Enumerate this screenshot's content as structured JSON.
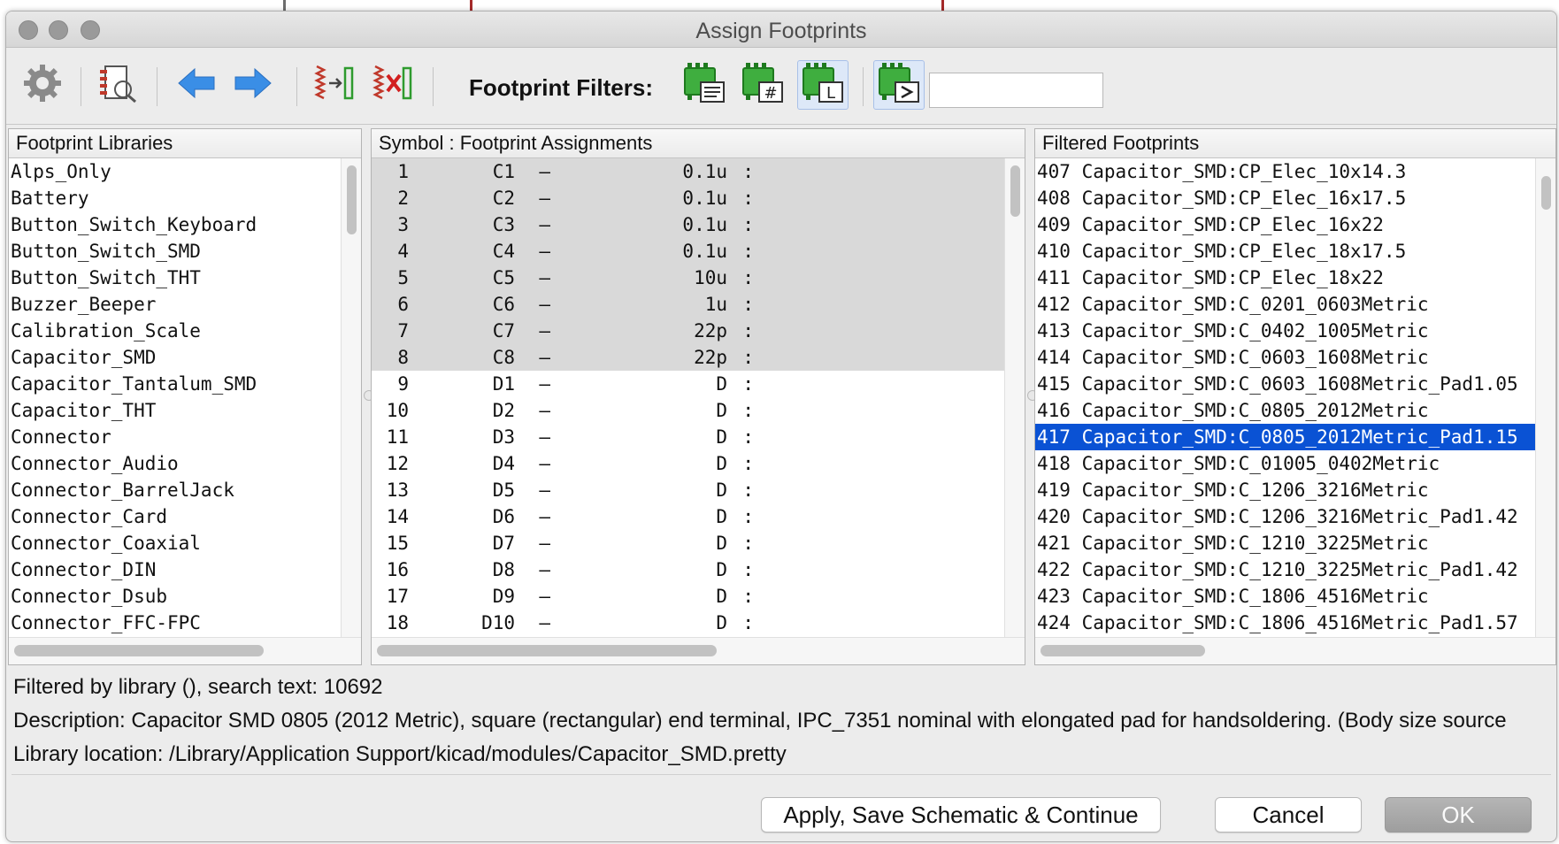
{
  "window": {
    "title": "Assign Footprints"
  },
  "toolbar": {
    "filters_label": "Footprint Filters:",
    "filter_text": ""
  },
  "libraries_panel": {
    "header": "Footprint Libraries",
    "items": [
      "Alps_Only",
      "Battery",
      "Button_Switch_Keyboard",
      "Button_Switch_SMD",
      "Button_Switch_THT",
      "Buzzer_Beeper",
      "Calibration_Scale",
      "Capacitor_SMD",
      "Capacitor_Tantalum_SMD",
      "Capacitor_THT",
      "Connector",
      "Connector_Audio",
      "Connector_BarrelJack",
      "Connector_Card",
      "Connector_Coaxial",
      "Connector_DIN",
      "Connector_Dsub",
      "Connector_FFC-FPC"
    ]
  },
  "assignments_panel": {
    "header": "Symbol : Footprint Assignments",
    "rows": [
      {
        "num": "1",
        "ref": "C1",
        "value": "0.1u"
      },
      {
        "num": "2",
        "ref": "C2",
        "value": "0.1u"
      },
      {
        "num": "3",
        "ref": "C3",
        "value": "0.1u"
      },
      {
        "num": "4",
        "ref": "C4",
        "value": "0.1u"
      },
      {
        "num": "5",
        "ref": "C5",
        "value": "10u"
      },
      {
        "num": "6",
        "ref": "C6",
        "value": "1u"
      },
      {
        "num": "7",
        "ref": "C7",
        "value": "22p"
      },
      {
        "num": "8",
        "ref": "C8",
        "value": "22p"
      },
      {
        "num": "9",
        "ref": "D1",
        "value": "D"
      },
      {
        "num": "10",
        "ref": "D2",
        "value": "D"
      },
      {
        "num": "11",
        "ref": "D3",
        "value": "D"
      },
      {
        "num": "12",
        "ref": "D4",
        "value": "D"
      },
      {
        "num": "13",
        "ref": "D5",
        "value": "D"
      },
      {
        "num": "14",
        "ref": "D6",
        "value": "D"
      },
      {
        "num": "15",
        "ref": "D7",
        "value": "D"
      },
      {
        "num": "16",
        "ref": "D8",
        "value": "D"
      },
      {
        "num": "17",
        "ref": "D9",
        "value": "D"
      },
      {
        "num": "18",
        "ref": "D10",
        "value": "D"
      }
    ],
    "shaded_count": 8
  },
  "footprints_panel": {
    "header": "Filtered Footprints",
    "items": [
      "407 Capacitor_SMD:CP_Elec_10x14.3",
      "408 Capacitor_SMD:CP_Elec_16x17.5",
      "409 Capacitor_SMD:CP_Elec_16x22",
      "410 Capacitor_SMD:CP_Elec_18x17.5",
      "411 Capacitor_SMD:CP_Elec_18x22",
      "412 Capacitor_SMD:C_0201_0603Metric",
      "413 Capacitor_SMD:C_0402_1005Metric",
      "414 Capacitor_SMD:C_0603_1608Metric",
      "415 Capacitor_SMD:C_0603_1608Metric_Pad1.05",
      "416 Capacitor_SMD:C_0805_2012Metric",
      "417 Capacitor_SMD:C_0805_2012Metric_Pad1.15",
      "418 Capacitor_SMD:C_01005_0402Metric",
      "419 Capacitor_SMD:C_1206_3216Metric",
      "420 Capacitor_SMD:C_1206_3216Metric_Pad1.42",
      "421 Capacitor_SMD:C_1210_3225Metric",
      "422 Capacitor_SMD:C_1210_3225Metric_Pad1.42",
      "423 Capacitor_SMD:C_1806_4516Metric",
      "424 Capacitor_SMD:C_1806_4516Metric_Pad1.57"
    ],
    "selected_index": 10
  },
  "status": {
    "filter_line": "Filtered by library (), search text: 10692",
    "description_line": "Description: Capacitor SMD 0805 (2012 Metric), square (rectangular) end terminal, IPC_7351 nominal with elongated pad for handsoldering. (Body size source",
    "location_line": "Library location: /Library/Application Support/kicad/modules/Capacitor_SMD.pretty"
  },
  "buttons": {
    "apply_label": "Apply, Save Schematic & Continue",
    "cancel_label": "Cancel",
    "ok_label": "OK"
  },
  "colors": {
    "selection": "#0a52d4",
    "shaded_row": "#d9d9d9",
    "arrow_blue": "#3a8ee6",
    "footprint_green": "#2e9b2e",
    "symbol_red": "#c0392b"
  },
  "icons": {
    "settings": "gear-icon",
    "view_footprint": "footprint-magnifier-icon",
    "prev": "arrow-left-icon",
    "next": "arrow-right-icon",
    "auto_assign": "auto-assign-icon",
    "delete_all": "delete-assignments-icon",
    "filter_keywords": "filter-by-keywords-icon",
    "filter_pincount": "filter-by-pin-count-icon",
    "filter_library": "filter-by-library-icon",
    "filter_text": "filter-by-text-icon"
  }
}
